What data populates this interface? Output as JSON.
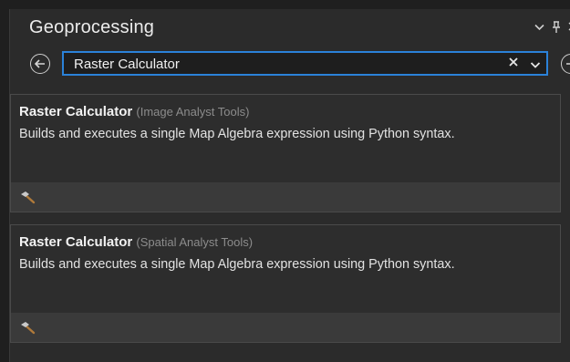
{
  "pane": {
    "title": "Geoprocessing",
    "menu_icon": "chevron-down-icon",
    "pin_icon": "pin-icon"
  },
  "search": {
    "value": "Raster Calculator",
    "clear_icon": "close-icon",
    "options_icon": "chevron-down-icon"
  },
  "results": [
    {
      "name": "Raster Calculator",
      "toolbox": "(Image Analyst Tools)",
      "description": "Builds and executes a single Map Algebra expression using Python syntax.",
      "icon": "hammer-icon"
    },
    {
      "name": "Raster Calculator",
      "toolbox": "(Spatial Analyst Tools)",
      "description": "Builds and executes a single Map Algebra expression using Python syntax.",
      "icon": "hammer-icon"
    }
  ],
  "colors": {
    "accent": "#2b82d9",
    "background": "#2b2b2b",
    "tool_icon": "#d08a3c"
  }
}
